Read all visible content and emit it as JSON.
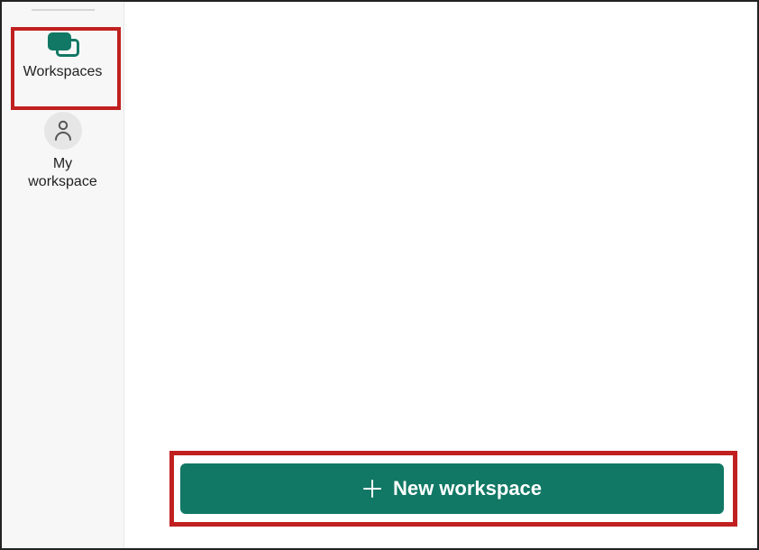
{
  "sidebar": {
    "workspaces_label": "Workspaces",
    "my_workspace_label": "My\nworkspace"
  },
  "main": {
    "new_workspace_label": "New workspace"
  },
  "colors": {
    "accent": "#117865",
    "highlight": "#c02020"
  }
}
